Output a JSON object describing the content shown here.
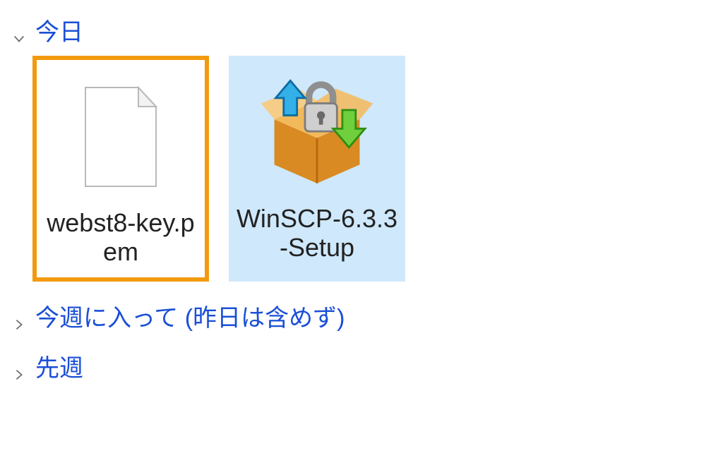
{
  "groups": {
    "today": {
      "label": "今日",
      "expanded": true,
      "items": [
        {
          "name": "webst8-key.pem",
          "type": "generic-file",
          "highlighted": true,
          "selected": false
        },
        {
          "name": "WinSCP-6.3.3-Setup",
          "type": "installer",
          "highlighted": false,
          "selected": true
        }
      ]
    },
    "earlier_this_week": {
      "label": "今週に入って (昨日は含めず)",
      "expanded": false
    },
    "last_week": {
      "label": "先週",
      "expanded": false
    }
  },
  "colors": {
    "link": "#1a4fd6",
    "highlight_border": "#f29a0e",
    "selection_bg": "#cfe8fb"
  }
}
